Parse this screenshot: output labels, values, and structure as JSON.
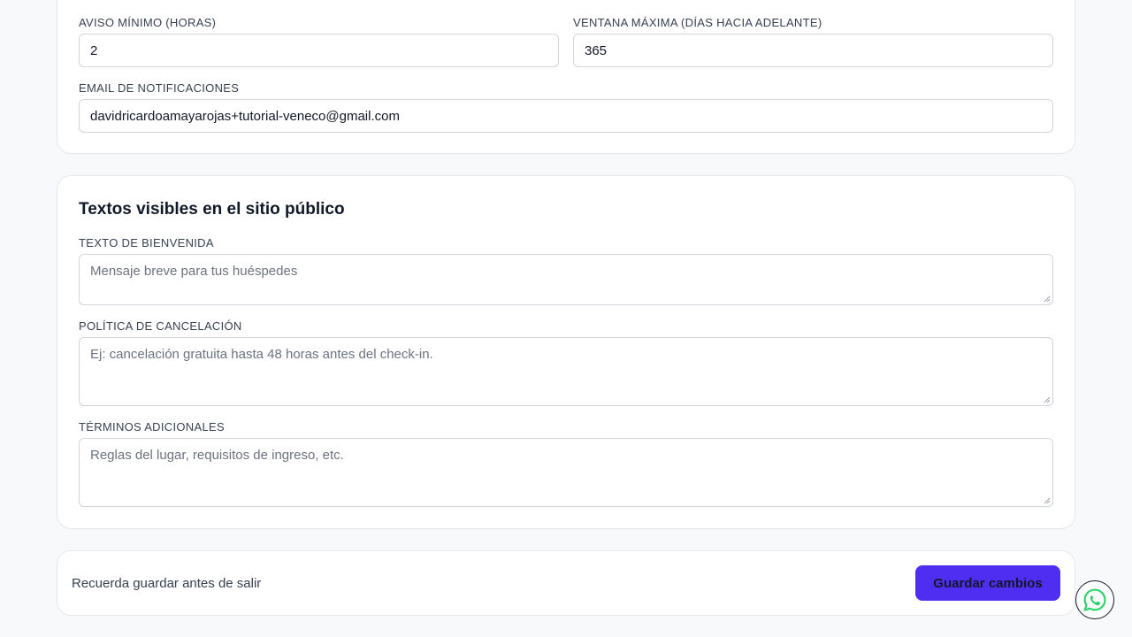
{
  "booking_rules": {
    "min_notice": {
      "label": "AVISO MÍNIMO (HORAS)",
      "value": "2"
    },
    "max_window": {
      "label": "VENTANA MÁXIMA (DÍAS HACIA ADELANTE)",
      "value": "365"
    },
    "notification_email": {
      "label": "EMAIL DE NOTIFICACIONES",
      "value": "davidricardoamayarojas+tutorial-veneco@gmail.com"
    }
  },
  "public_texts": {
    "title": "Textos visibles en el sitio público",
    "welcome": {
      "label": "TEXTO DE BIENVENIDA",
      "placeholder": "Mensaje breve para tus huéspedes"
    },
    "cancellation": {
      "label": "POLÍTICA DE CANCELACIÓN",
      "placeholder": "Ej: cancelación gratuita hasta 48 horas antes del check-in."
    },
    "terms": {
      "label": "TÉRMINOS ADICIONALES",
      "placeholder": "Reglas del lugar, requisitos de ingreso, etc."
    }
  },
  "footer": {
    "reminder": "Recuerda guardar antes de salir",
    "save_label": "Guardar cambios"
  },
  "colors": {
    "accent": "#4f2ef2",
    "whatsapp": "#25d366",
    "border": "#d1d5db"
  },
  "icons": {
    "floating": "whatsapp-icon"
  }
}
